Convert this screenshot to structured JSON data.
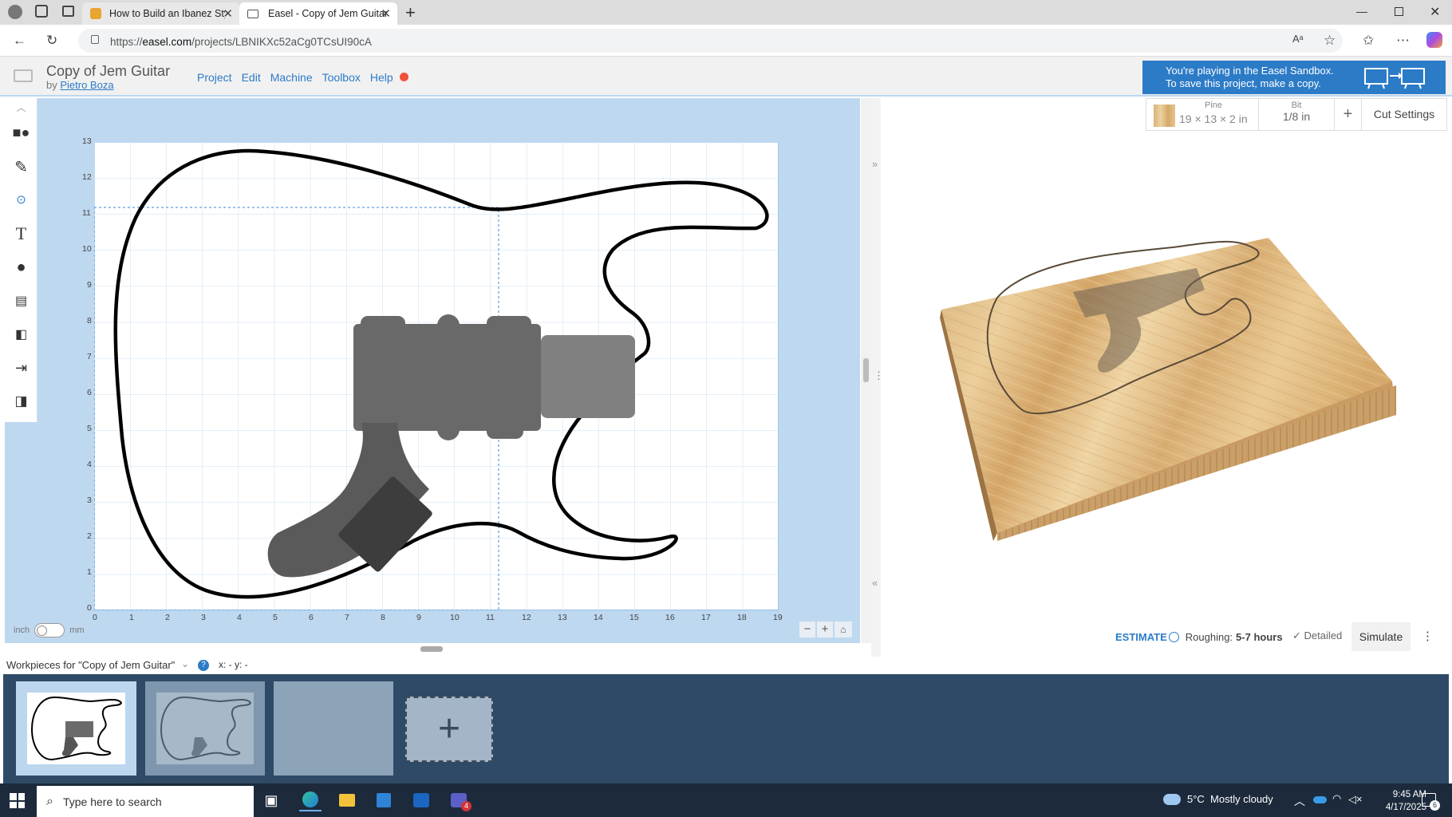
{
  "browser": {
    "tabs": [
      {
        "title": "How to Build an Ibanez Style Elect",
        "active": false
      },
      {
        "title": "Easel - Copy of Jem Guitar",
        "active": true
      }
    ],
    "url_prefix": "https://",
    "url_host": "easel.com",
    "url_path": "/projects/LBNIKXc52aCg0TCsUI90cA"
  },
  "app": {
    "project_title": "Copy of Jem Guitar",
    "by_label": "by",
    "author": "Pietro Boza",
    "menu": [
      "Project",
      "Edit",
      "Machine",
      "Toolbox",
      "Help"
    ],
    "sandbox_line1": "You're playing in the Easel Sandbox.",
    "sandbox_line2": "To save this project, make a copy."
  },
  "material": {
    "label": "Pine",
    "size": "19 × 13 × 2 in",
    "bit_label": "Bit",
    "bit_value": "1/8 in",
    "add": "+",
    "cut_settings": "Cut Settings"
  },
  "canvas": {
    "x_ticks": [
      "0",
      "1",
      "2",
      "3",
      "4",
      "5",
      "6",
      "7",
      "8",
      "9",
      "10",
      "11",
      "12",
      "13",
      "14",
      "15",
      "16",
      "17",
      "18",
      "19"
    ],
    "y_ticks": [
      "0",
      "1",
      "2",
      "3",
      "4",
      "5",
      "6",
      "7",
      "8",
      "9",
      "10",
      "11",
      "12",
      "13"
    ],
    "unit_left": "inch",
    "unit_right": "mm",
    "zoom_out": "−",
    "zoom_in": "+"
  },
  "estimate": {
    "label": "ESTIMATE",
    "roughing_label": "Roughing:",
    "roughing_value": "5-7 hours",
    "detailed": "Detailed",
    "simulate": "Simulate"
  },
  "workpieces": {
    "label": "Workpieces for \"Copy of Jem Guitar\"",
    "help": "?",
    "coords": "x: - y: -"
  },
  "taskbar": {
    "search_placeholder": "Type here to search",
    "weather": "5°C  Mostly cloudy",
    "time": "9:45 AM",
    "date": "4/17/2025",
    "notif_count": "6",
    "teams_badge": "4"
  },
  "colors": {
    "accent": "#2c7bc7",
    "canvas_bg": "#bed8f0",
    "workpiece_bg": "#2e4a66",
    "taskbar": "#1c2a3c"
  }
}
